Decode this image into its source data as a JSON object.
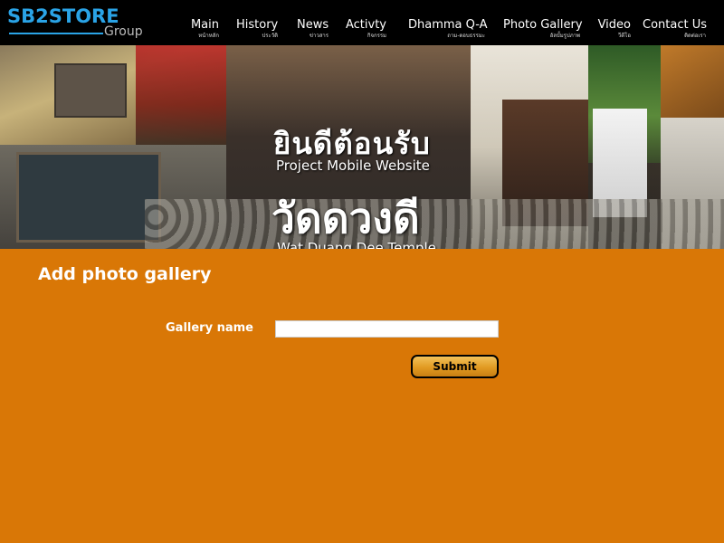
{
  "header": {
    "logo_main": "SB2STORE",
    "logo_sub": "Group",
    "nav": [
      {
        "en": "Main",
        "th": "หน้าหลัก"
      },
      {
        "en": "History",
        "th": "ประวัติ"
      },
      {
        "en": "News",
        "th": "ข่าวสาร"
      },
      {
        "en": "Activty",
        "th": "กิจกรรม"
      },
      {
        "en": "Dhamma Q-A",
        "th": "ถาม-ตอบธรรมะ"
      },
      {
        "en": "Photo Gallery",
        "th": "อัลบั้มรูปภาพ"
      },
      {
        "en": "Video",
        "th": "วีดีโอ"
      },
      {
        "en": "Contact Us",
        "th": "ติดต่อเรา"
      }
    ]
  },
  "banner": {
    "welcome_th": "ยินดีต้อนรับ",
    "welcome_en": "Project Mobile Website",
    "temple_th": "วัดดวงดี",
    "temple_en": "Wat Duang Dee Temple"
  },
  "form": {
    "title": "Add photo gallery",
    "gallery_name_label": "Gallery name",
    "gallery_name_value": "",
    "submit_label": "Submit"
  },
  "colors": {
    "page_bg": "#D97706",
    "header_bg": "#000000",
    "logo_blue": "#2AA3E6",
    "button_gold": "#E19A22"
  }
}
